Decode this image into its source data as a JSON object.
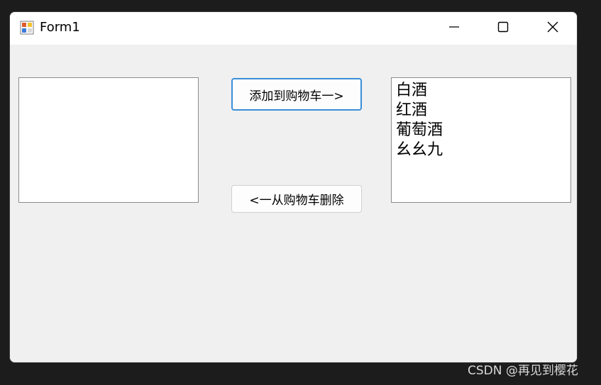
{
  "window": {
    "title": "Form1",
    "controls": {
      "minimize": "minimize-icon",
      "maximize": "maximize-icon",
      "close": "close-icon"
    }
  },
  "left_list": {
    "items": []
  },
  "right_list": {
    "items": [
      "白酒",
      "红酒",
      "葡萄酒",
      "幺幺九"
    ]
  },
  "buttons": {
    "add_label": "添加到购物车一>",
    "remove_label": "<一从购物车删除"
  },
  "watermark": "CSDN @再见到樱花",
  "colors": {
    "accent_border": "#3b8fd9",
    "window_bg": "#f0f0f0",
    "background": "#1c1c1c"
  }
}
